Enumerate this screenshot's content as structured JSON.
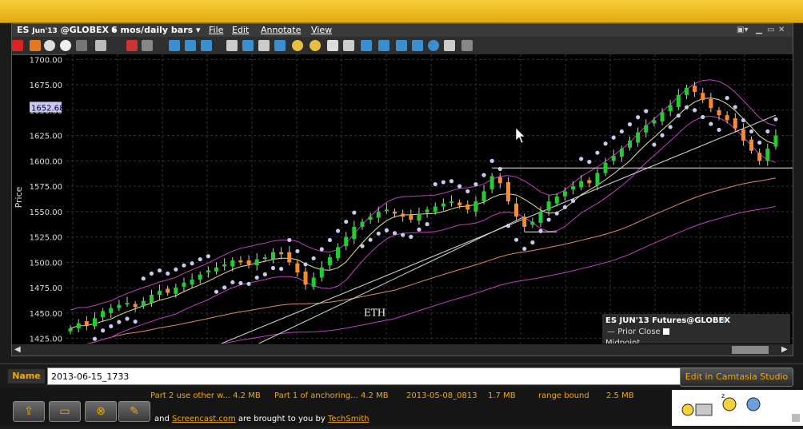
{
  "chart_header": {
    "symbol": "ES",
    "contract": "Jun'13",
    "exchange": "@GLOBEX",
    "period": "6 mos/daily bars",
    "menus": [
      "File",
      "Edit",
      "Annotate",
      "View"
    ]
  },
  "chart_data": {
    "type": "candlestick",
    "ylabel": "Price",
    "ylim": [
      1420,
      1705
    ],
    "y_ticks": [
      "1700.00",
      "1675.00",
      "1650.00",
      "1625.00",
      "1600.00",
      "1575.00",
      "1550.00",
      "1525.00",
      "1500.00",
      "1475.00",
      "1450.00",
      "1425.00"
    ],
    "last_price_label": "1652.68",
    "annotation": "ETH",
    "legend": {
      "title": "ES JUN'13 Futures@GLOBEX",
      "items": [
        "Prior Close",
        "Midpoint"
      ]
    },
    "colors": {
      "up": "#22cc33",
      "down": "#ff8a2a",
      "sar": "#c8c8f0",
      "envelope": "#c040c0",
      "ma_fast": "#e6e08a",
      "ma_slow": "#e08a6a",
      "trend": "#d8d8d8"
    },
    "close_approx": [
      1435,
      1440,
      1438,
      1445,
      1452,
      1455,
      1458,
      1460,
      1456,
      1462,
      1468,
      1472,
      1470,
      1475,
      1480,
      1483,
      1488,
      1492,
      1495,
      1498,
      1502,
      1500,
      1498,
      1503,
      1505,
      1510,
      1508,
      1500,
      1490,
      1478,
      1485,
      1495,
      1505,
      1515,
      1525,
      1535,
      1540,
      1545,
      1550,
      1552,
      1548,
      1545,
      1542,
      1548,
      1552,
      1555,
      1558,
      1560,
      1556,
      1552,
      1560,
      1570,
      1585,
      1578,
      1560,
      1545,
      1535,
      1540,
      1550,
      1560,
      1565,
      1570,
      1575,
      1580,
      1578,
      1588,
      1598,
      1605,
      1612,
      1620,
      1628,
      1635,
      1640,
      1648,
      1655,
      1665,
      1672,
      1668,
      1660,
      1652,
      1645,
      1640,
      1632,
      1620,
      1610,
      1600,
      1612,
      1625
    ]
  },
  "recording": {
    "name_label": "Name",
    "name_value": "2013-06-15_1733",
    "edit_label": "Edit in Camtasia Studio",
    "files": [
      "Part 2 use other w... 4.2 MB",
      "Part 1 of anchoring... 4.2 MB",
      "2013-05-08_0813",
      "1.7 MB",
      "range bound",
      "2.5 MB"
    ],
    "credit": {
      "pre": "and",
      "link1": "Screencast.com",
      "mid": "are brought to you by",
      "link2": "TechSmith"
    }
  }
}
